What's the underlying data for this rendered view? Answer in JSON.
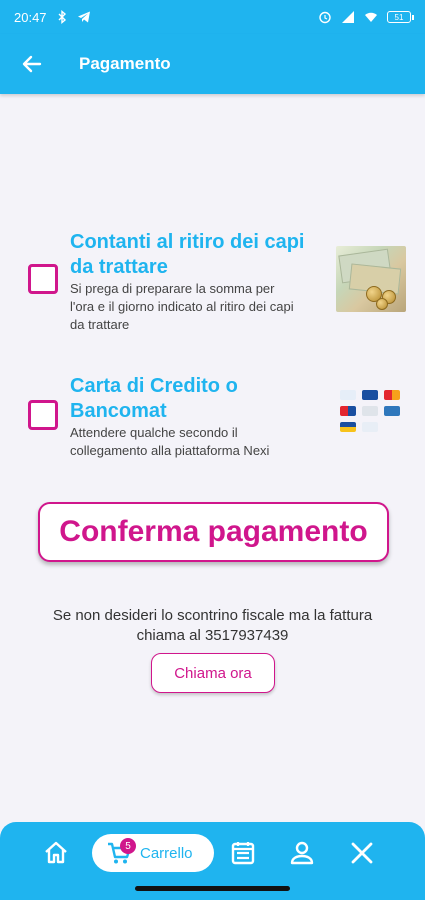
{
  "statusbar": {
    "time": "20:47",
    "battery": "51"
  },
  "appbar": {
    "title": "Pagamento"
  },
  "options": [
    {
      "title_line1": "Contanti al ritiro dei capi",
      "title_line2": "da trattare",
      "desc_line1": "Si prega di preparare la somma per",
      "desc_line2": "l'ora e il giorno indicato al ritiro dei capi",
      "desc_line3": "da trattare",
      "checked": false
    },
    {
      "title_line1": "Carta di Credito o",
      "title_line2": "Bancomat",
      "desc_line1": "Attendere qualche secondo il",
      "desc_line2": "collegamento alla piattaforma Nexi",
      "checked": false
    }
  ],
  "confirm_label": "Conferma pagamento",
  "invoice": {
    "line1": "Se non desideri lo scontrino fiscale ma la fattura",
    "line2": "chiama al 3517937439",
    "call_label": "Chiama ora"
  },
  "bottomnav": {
    "cart_label": "Carrello",
    "cart_count": "5",
    "items": [
      "home-icon",
      "cart-icon",
      "calendar-icon",
      "profile-icon",
      "close-icon"
    ]
  },
  "colors": {
    "primary": "#1fb4ef",
    "accent": "#d0168c",
    "background": "#f4f3f9"
  }
}
